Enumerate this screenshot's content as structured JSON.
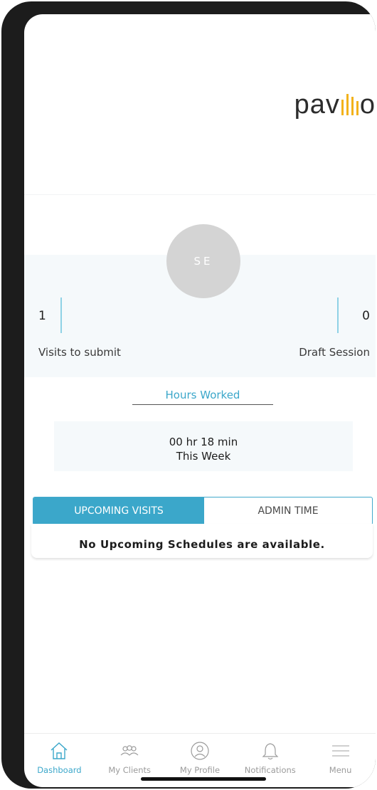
{
  "logo": {
    "text_before": "pav",
    "text_after": "o"
  },
  "avatar": {
    "initials": "SE"
  },
  "stats": {
    "visits_count": "1",
    "visits_label": "Visits to submit",
    "draft_count": "0",
    "draft_label": "Draft Session"
  },
  "hours": {
    "tab_label": "Hours Worked",
    "value": "00 hr 18 min",
    "period": "This Week"
  },
  "tabs": {
    "upcoming_label": "UPCOMING VISITS",
    "admin_label": "ADMIN TIME"
  },
  "empty_message": "No Upcoming Schedules are available.",
  "nav": {
    "dashboard": "Dashboard",
    "my_clients": "My Clients",
    "my_profile": "My Profile",
    "notifications": "Notifications",
    "menu": "Menu"
  },
  "colors": {
    "accent": "#3ba7ca",
    "brand_bars": "#f2b21b"
  }
}
